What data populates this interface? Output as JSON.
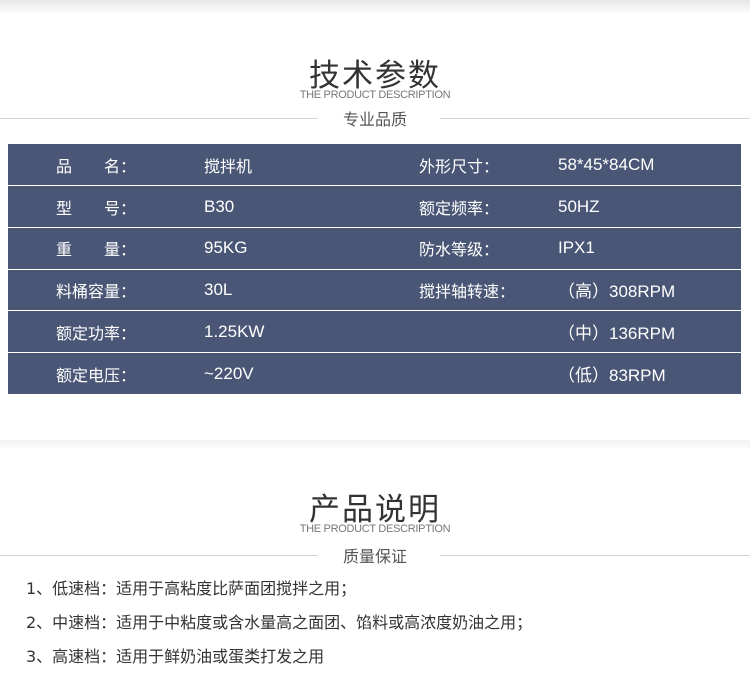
{
  "spec_section": {
    "title": "技术参数",
    "subtitle_en": "THE PRODUCT DESCRIPTION",
    "subtitle_cn": "专业品质"
  },
  "spec_rows": [
    {
      "label1": "品　　名：",
      "value1": "搅拌机",
      "label2": "外形尺寸：",
      "value2": "58*45*84CM"
    },
    {
      "label1": "型　　号：",
      "value1": "B30",
      "label2": "额定频率：",
      "value2": "50HZ"
    },
    {
      "label1": "重　　量：",
      "value1": "95KG",
      "label2": "防水等级：",
      "value2": "IPX1"
    },
    {
      "label1": "料桶容量：",
      "value1": "30L",
      "label2": "搅拌轴转速：",
      "value2": "（高）308RPM"
    },
    {
      "label1": "额定功率：",
      "value1": "1.25KW",
      "label2": "",
      "value2": "（中）136RPM"
    },
    {
      "label1": "额定电压：",
      "value1": "~220V",
      "label2": "",
      "value2": "（低）83RPM"
    }
  ],
  "desc_section": {
    "title": "产品说明",
    "subtitle_en": "THE PRODUCT DESCRIPTION",
    "subtitle_cn": "质量保证",
    "items": [
      "1、低速档：适用于高粘度比萨面团搅拌之用；",
      "2、中速档：适用于中粘度或含水量高之面团、馅料或高浓度奶油之用；",
      "3、高速档：适用于鲜奶油或蛋类打发之用"
    ]
  },
  "colors": {
    "table_bg": "#4a5675",
    "table_text": "#ffffff",
    "heading_text": "#333333"
  }
}
